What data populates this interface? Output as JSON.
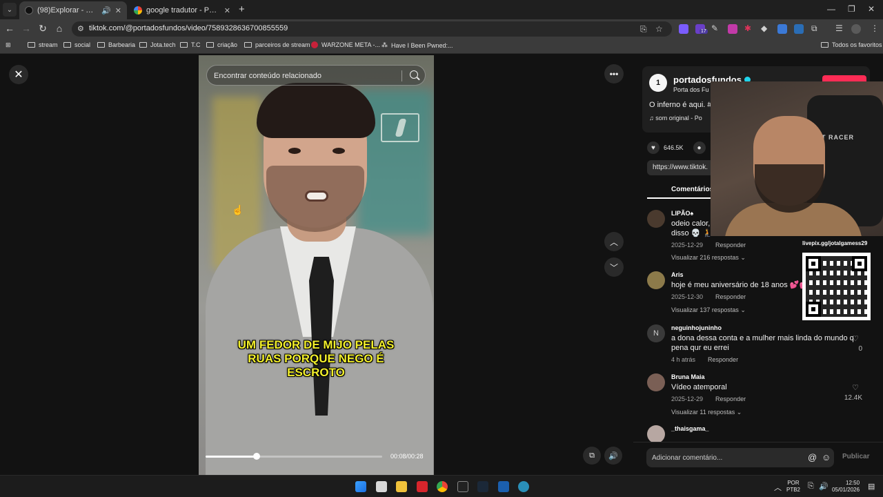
{
  "browser": {
    "tabs": [
      {
        "title": "(98)Explorar - Encontre seu",
        "active": true
      },
      {
        "title": "google tradutor - Pesquisa Goo",
        "active": false
      }
    ],
    "url": "tiktok.com/@portadosfundos/video/7589328636700855559",
    "bookmarks": [
      "stream",
      "social",
      "Barbearia",
      "Jota.tech",
      "T.C",
      "criação",
      "parceiros de stream",
      "WARZONE META -...",
      "Have I Been Pwned:..."
    ],
    "all_bookmarks_label": "Todos os favoritos",
    "extension_badge": "17"
  },
  "video": {
    "search_placeholder": "Encontrar conteúdo relacionado",
    "caption_lines": [
      "UM FEDOR DE MIJO PELAS",
      "RUAS PORQUE NEGO É",
      "ESCROTO"
    ],
    "time": "00:08/00:28",
    "progress": 0.29
  },
  "author": {
    "name": "portadosfundos",
    "subtitle": "Porta dos Fu",
    "description": "O inferno é aqui. #",
    "sound": "som original - Po",
    "avatar_text": "1"
  },
  "stats": {
    "likes": "646.5K"
  },
  "link_text": "https://www.tiktok.",
  "comments_tab": "Comentários",
  "comments": [
    {
      "user": "LIPÃO♠",
      "text": "odeio calor,\ndisso 💀 🧎",
      "date": "2025-12-29",
      "reply": "Responder",
      "more": "Visualizar 216 respostas",
      "likes": "",
      "avatar_color": "#4a3a2e"
    },
    {
      "user": "Aris",
      "text": "hoje é meu aniversário de 18 anos 💕💕",
      "date": "2025-12-30",
      "reply": "Responder",
      "more": "Visualizar 137 respostas",
      "likes": "",
      "avatar_color": "#8c7a4a"
    },
    {
      "user": "neguinhojuninho",
      "text": "a dona dessa conta e a mulher mais linda do mundo q pena qur eu errei",
      "date": "4 h atrás",
      "reply": "Responder",
      "more": "",
      "likes": "0",
      "avatar_color": "#3a3a3a",
      "avatar_letter": "N"
    },
    {
      "user": "Bruna Maia",
      "text": "Vídeo atemporal",
      "date": "2025-12-29",
      "reply": "Responder",
      "more": "Visualizar 11 respostas",
      "likes": "12.4K",
      "avatar_color": "#7a5f55"
    },
    {
      "user": "_thaisgama_",
      "text": "",
      "date": "",
      "reply": "",
      "more": "",
      "likes": "",
      "avatar_color": "#b7a7a2"
    }
  ],
  "comment_input": {
    "placeholder": "Adicionar comentário...",
    "publish": "Publicar"
  },
  "overlay": {
    "livepix": "livepix.gg/jotalgamess29",
    "chair_brand": "XT RACER"
  },
  "taskbar": {
    "lang_top": "POR",
    "lang_bottom": "PTB2",
    "time": "12:50",
    "date": "05/01/2026"
  },
  "colors": {
    "accent": "#fe2c55",
    "caption": "#f2ef2b",
    "verified": "#20d5ec"
  }
}
